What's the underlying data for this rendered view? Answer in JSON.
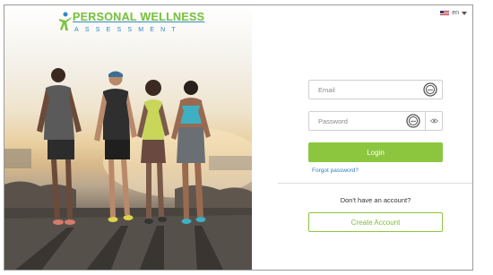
{
  "brand": {
    "title": "PERSONAL WELLNESS",
    "subtitle": "ASSESSMENT"
  },
  "language": {
    "selected": "en"
  },
  "login": {
    "email_placeholder": "Email",
    "password_placeholder": "Password",
    "login_label": "Login",
    "forgot_label": "Forgot password?",
    "no_account_text": "Don't have an account?",
    "create_label": "Create Account"
  },
  "colors": {
    "accent_green": "#8cc63f",
    "brand_blue": "#2f89c9",
    "link_blue": "#2f7fc1"
  },
  "icons": {
    "password_manager": "password-autofill-icon",
    "show_password": "eye-icon",
    "language_flag": "us-flag-icon"
  }
}
